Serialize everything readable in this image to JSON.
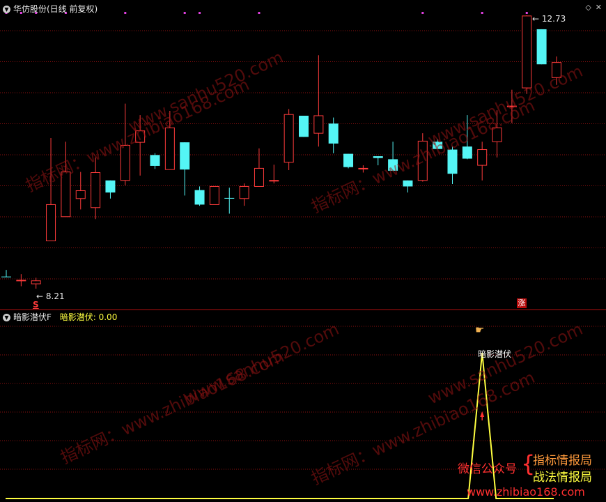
{
  "top_panel": {
    "title": "华仿股份(日线 前复权)",
    "high_label": "12.73",
    "low_label": "8.21",
    "s_marker": "S",
    "zhang_badge": "涨"
  },
  "bottom_panel": {
    "title": "暗影潜伏F",
    "indicator_name": "暗影潜伏:",
    "indicator_value": "0.00",
    "peak_label": "暗影潜伏"
  },
  "watermarks": [
    "指标网：www.zhibiao168.com",
    "www.sanhu520.com"
  ],
  "promo": {
    "wechat": "微信公众号",
    "brace": "{",
    "line1": "指标情报局",
    "line2": "战法情报局",
    "site": "www.zhibiao168.com"
  },
  "colors": {
    "up": "#ff3b3b",
    "down": "#54f5f5",
    "grid": "#8b1010",
    "indicator": "#ffff40",
    "magenta": "#e040e0",
    "bg": "#000000"
  },
  "chart_data": {
    "type": "candlestick",
    "candles": [
      {
        "o": 8.41,
        "c": 8.4,
        "h": 8.52,
        "l": 8.4
      },
      {
        "o": 8.35,
        "c": 8.35,
        "h": 8.45,
        "l": 8.25
      },
      {
        "o": 8.29,
        "c": 8.34,
        "h": 8.39,
        "l": 8.21
      },
      {
        "o": 9.0,
        "c": 9.6,
        "h": 10.7,
        "l": 9.0
      },
      {
        "o": 9.4,
        "c": 10.14,
        "h": 10.64,
        "l": 9.4
      },
      {
        "o": 9.7,
        "c": 9.83,
        "h": 10.14,
        "l": 9.52
      },
      {
        "o": 9.55,
        "c": 10.13,
        "h": 10.38,
        "l": 9.36
      },
      {
        "o": 10.0,
        "c": 9.8,
        "h": 10.0,
        "l": 9.7
      },
      {
        "o": 10.0,
        "c": 10.58,
        "h": 11.27,
        "l": 9.92
      },
      {
        "o": 10.63,
        "c": 10.82,
        "h": 11.08,
        "l": 10.08
      },
      {
        "o": 10.42,
        "c": 10.24,
        "h": 10.45,
        "l": 10.19
      },
      {
        "o": 10.18,
        "c": 10.87,
        "h": 11.15,
        "l": 10.18
      },
      {
        "o": 10.63,
        "c": 10.18,
        "h": 10.63,
        "l": 9.75
      },
      {
        "o": 9.84,
        "c": 9.6,
        "h": 9.9,
        "l": 9.58
      },
      {
        "o": 9.6,
        "c": 9.9,
        "h": 9.9,
        "l": 9.6
      },
      {
        "o": 9.71,
        "c": 9.7,
        "h": 9.88,
        "l": 9.45
      },
      {
        "o": 9.7,
        "c": 9.9,
        "h": 9.95,
        "l": 9.58
      },
      {
        "o": 9.9,
        "c": 10.2,
        "h": 10.53,
        "l": 9.9
      },
      {
        "o": 10.0,
        "c": 10.0,
        "h": 10.26,
        "l": 9.95
      },
      {
        "o": 10.3,
        "c": 11.09,
        "h": 11.18,
        "l": 10.17
      },
      {
        "o": 11.07,
        "c": 10.72,
        "h": 11.07,
        "l": 10.72
      },
      {
        "o": 10.78,
        "c": 11.07,
        "h": 12.07,
        "l": 10.56
      },
      {
        "o": 10.94,
        "c": 10.61,
        "h": 11.04,
        "l": 10.45
      },
      {
        "o": 10.44,
        "c": 10.22,
        "h": 10.44,
        "l": 10.2
      },
      {
        "o": 10.2,
        "c": 10.2,
        "h": 10.25,
        "l": 10.13
      },
      {
        "o": 10.4,
        "c": 10.37,
        "h": 10.4,
        "l": 10.25
      },
      {
        "o": 10.35,
        "c": 10.16,
        "h": 10.64,
        "l": 10.16
      },
      {
        "o": 10.0,
        "c": 9.9,
        "h": 10.0,
        "l": 9.8
      },
      {
        "o": 10.0,
        "c": 10.65,
        "h": 10.78,
        "l": 9.98
      },
      {
        "o": 10.64,
        "c": 10.52,
        "h": 10.68,
        "l": 10.52
      },
      {
        "o": 10.51,
        "c": 10.11,
        "h": 10.56,
        "l": 9.94
      },
      {
        "o": 10.56,
        "c": 10.36,
        "h": 11.08,
        "l": 10.35
      },
      {
        "o": 10.25,
        "c": 10.51,
        "h": 10.64,
        "l": 10.0
      },
      {
        "o": 10.64,
        "c": 10.87,
        "h": 11.16,
        "l": 10.38
      },
      {
        "o": 11.23,
        "c": 11.23,
        "h": 11.5,
        "l": 10.95
      },
      {
        "o": 11.53,
        "c": 12.72,
        "h": 12.73,
        "l": 11.43
      },
      {
        "o": 12.5,
        "c": 11.92,
        "h": 12.5,
        "l": 11.92
      },
      {
        "o": 11.7,
        "c": 11.95,
        "h": 12.05,
        "l": 11.58
      }
    ],
    "indicator": {
      "values": [
        0,
        0,
        0,
        0,
        0,
        0,
        0,
        0,
        0,
        0,
        0,
        0,
        0,
        0,
        0,
        0,
        0,
        0,
        0,
        0,
        0,
        0,
        0,
        0,
        0,
        0,
        0,
        0,
        0,
        0,
        0,
        0,
        1,
        0,
        0,
        0,
        0,
        0
      ],
      "peak_index": 32
    }
  }
}
